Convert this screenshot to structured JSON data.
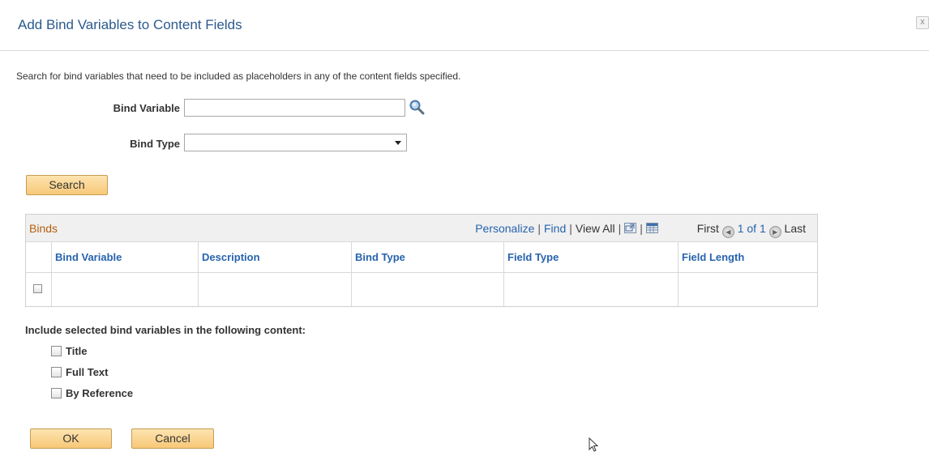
{
  "dialog": {
    "title": "Add Bind Variables to Content Fields",
    "close_glyph": "x",
    "instructions": "Search for bind variables that need to be included as placeholders in any of the content fields specified."
  },
  "search_form": {
    "bind_variable_label": "Bind Variable",
    "bind_variable_value": "",
    "bind_type_label": "Bind Type",
    "bind_type_selected": "",
    "search_button": "Search"
  },
  "grid": {
    "title": "Binds",
    "personalize": "Personalize",
    "find": "Find",
    "view_all": "View All",
    "first": "First",
    "page_info": "1 of 1",
    "last": "Last",
    "columns": [
      "Bind Variable",
      "Description",
      "Bind Type",
      "Field Type",
      "Field Length"
    ],
    "rows": [
      {
        "selected": false,
        "cells": [
          "",
          "",
          "",
          "",
          ""
        ]
      }
    ]
  },
  "content_options": {
    "heading": "Include selected bind variables in the following content:",
    "options": [
      {
        "label": "Title",
        "checked": false
      },
      {
        "label": "Full Text",
        "checked": false
      },
      {
        "label": "By Reference",
        "checked": false
      }
    ]
  },
  "footer": {
    "ok_button": "OK",
    "cancel_button": "Cancel"
  },
  "icons": {
    "lookup": "magnifier-icon",
    "new_window": "new-window-icon",
    "download": "spreadsheet-download-icon",
    "prev": "prev-arrow-icon",
    "next": "next-arrow-icon"
  },
  "colors": {
    "title": "#2b5a8c",
    "grid_title": "#b25f0e",
    "link": "#2763ad",
    "button": "#f7c878"
  }
}
